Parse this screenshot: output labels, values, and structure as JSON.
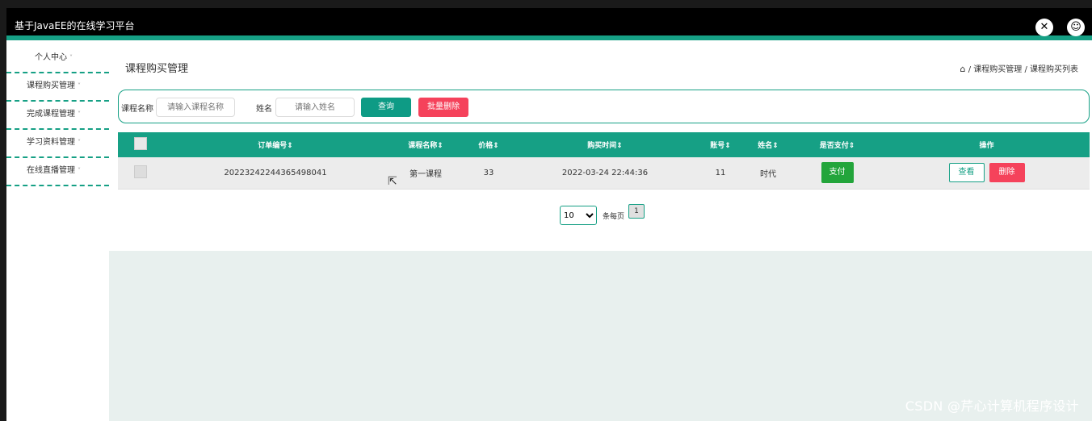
{
  "app": {
    "title": "基于JavaEE的在线学习平台",
    "close_icon": "close-circle-icon",
    "user_icon": "user-icon"
  },
  "sidebar": {
    "items": [
      {
        "label": "个人中心"
      },
      {
        "label": "课程购买管理"
      },
      {
        "label": "完成课程管理"
      },
      {
        "label": "学习资料管理"
      },
      {
        "label": "在线直播管理"
      }
    ],
    "chevron": "˅"
  },
  "page": {
    "title": "课程购买管理",
    "breadcrumb": {
      "home_icon": "⌂",
      "path": "/ 课程购买管理 / 课程购买列表"
    }
  },
  "search": {
    "course_label": "课程名称",
    "course_placeholder": "请输入课程名称",
    "name_label": "姓名",
    "name_placeholder": "请输入姓名",
    "query_button": "查询",
    "bulk_delete_button": "批量删除"
  },
  "table": {
    "headers": {
      "order_no": "订单编号⇕",
      "course_name": "课程名称⇕",
      "price": "价格⇕",
      "purchase_time": "购买时间⇕",
      "account": "账号⇕",
      "name": "姓名⇕",
      "paid": "是否支付⇕",
      "actions": "操作"
    },
    "rows": [
      {
        "order_no": "20223242244365498041",
        "course_name": "第一课程",
        "price": "33",
        "purchase_time": "2022-03-24 22:44:36",
        "account": "11",
        "name": "时代",
        "pay_button": "支付",
        "view_button": "查看",
        "delete_button": "删除"
      }
    ]
  },
  "pagination": {
    "page_size": "10",
    "per_page_label": "条每页",
    "current_page": "1"
  },
  "watermark": "CSDN @芹心计算机程序设计",
  "colors": {
    "accent": "#16a085",
    "danger": "#f5425b",
    "success": "#23a53b"
  }
}
